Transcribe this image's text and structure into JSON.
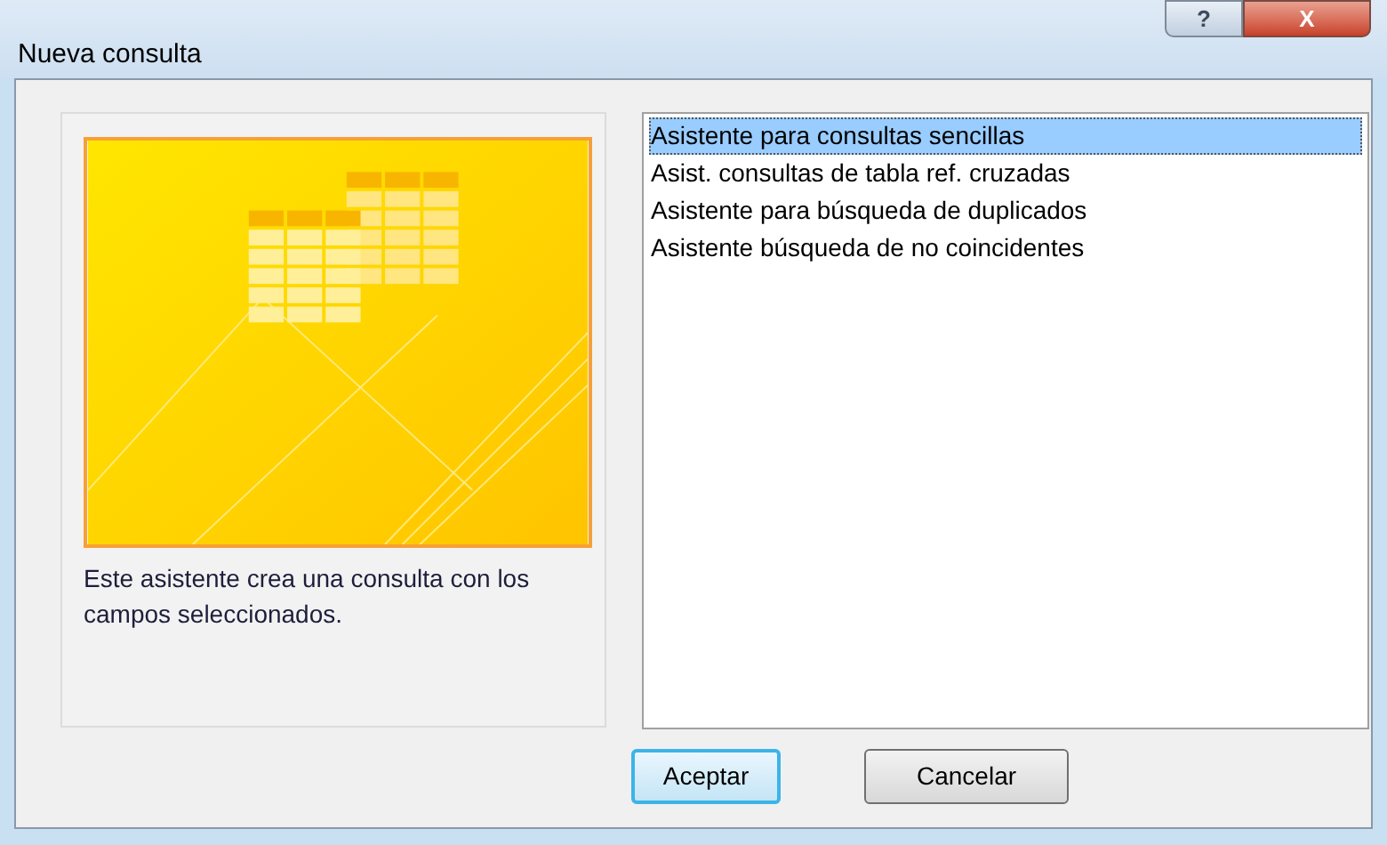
{
  "window": {
    "title": "Nueva consulta",
    "controls": [
      {
        "kind": "help",
        "label": "?"
      },
      {
        "kind": "close",
        "label": "X"
      }
    ]
  },
  "preview": {
    "description": "Este asistente crea una consulta con los campos seleccionados."
  },
  "wizards": [
    {
      "label": "Asistente para consultas sencillas",
      "selected": true
    },
    {
      "label": "Asist. consultas de tabla ref. cruzadas",
      "selected": false
    },
    {
      "label": "Asistente para búsqueda de duplicados",
      "selected": false
    },
    {
      "label": "Asistente búsqueda de no coincidentes",
      "selected": false
    }
  ],
  "buttons": [
    {
      "label": "Aceptar",
      "default": true
    },
    {
      "label": "Cancelar",
      "default": false
    }
  ]
}
